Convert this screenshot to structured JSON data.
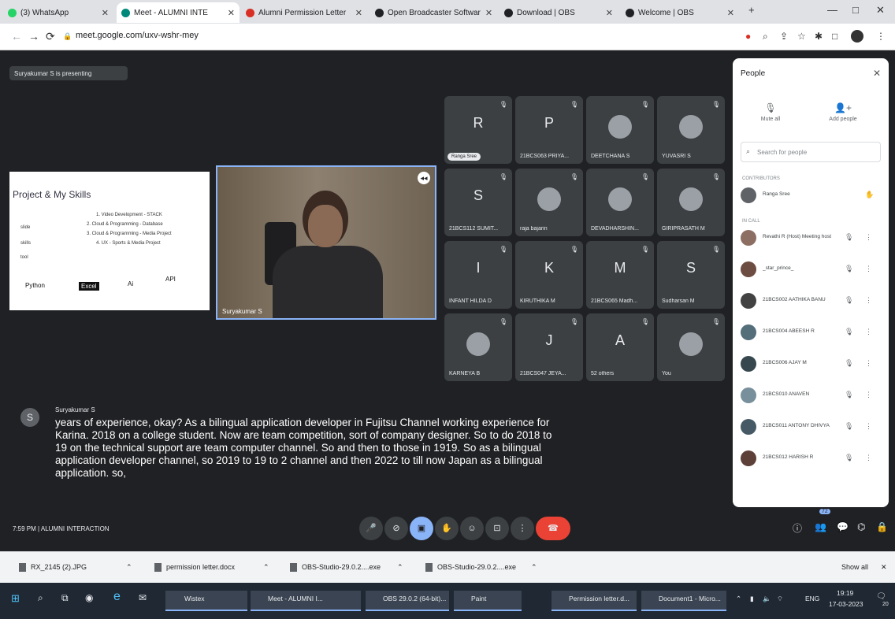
{
  "browser": {
    "tabs": [
      {
        "label": "(3) WhatsApp",
        "icon_color": "#25d366",
        "active": false
      },
      {
        "label": "Meet - ALUMNI INTE",
        "icon_color": "#00897b",
        "active": true
      },
      {
        "label": "Alumni Permission Letter",
        "icon_color": "#d93025",
        "active": false
      },
      {
        "label": "Open Broadcaster Softwar",
        "icon_color": "#202124",
        "active": false
      },
      {
        "label": "Download | OBS",
        "icon_color": "#202124",
        "active": false
      },
      {
        "label": "Welcome | OBS",
        "icon_color": "#202124",
        "active": false
      }
    ],
    "new_tab": "+",
    "window": {
      "minimize": "—",
      "maximize": "□",
      "close": "✕"
    },
    "url": "meet.google.com/uxv-wshr-mey"
  },
  "meet": {
    "presenting_banner": "Suryakumar S is presenting",
    "slide": {
      "title": "Project & My Skills",
      "lines": [
        "1. Video Development - STACK",
        "2. Cloud & Programming - Database",
        "3. Cloud & Programming - Media Project",
        "4. UX - Sports & Media Project"
      ],
      "side_labels": [
        "slide",
        "skills",
        "tool"
      ],
      "logos": [
        "Python",
        "Excel",
        "Ai",
        "API"
      ]
    },
    "camera": {
      "name": "Suryakumar S"
    },
    "participants": [
      {
        "initial": "R",
        "name": "Ranga Sree",
        "badge": true
      },
      {
        "initial": "P",
        "name": "21BCS063 PRIYA..."
      },
      {
        "initial": "",
        "name": "DEETCHANA S"
      },
      {
        "initial": "",
        "name": "YUVASRI S"
      },
      {
        "initial": "S",
        "name": "21BCS112 SUMIT..."
      },
      {
        "initial": "",
        "name": "raja bajarin"
      },
      {
        "initial": "",
        "name": "DEVADHARSHIN..."
      },
      {
        "initial": "",
        "name": "GIRIPRASATH M"
      },
      {
        "initial": "I",
        "name": "INFANT HILDA D"
      },
      {
        "initial": "K",
        "name": "KIRUTHIKA M"
      },
      {
        "initial": "M",
        "name": "21BCS065 Madh..."
      },
      {
        "initial": "S",
        "name": "Sudharsan M"
      },
      {
        "initial": "",
        "name": "KARNEYA B"
      },
      {
        "initial": "J",
        "name": "21BCS047 JEYA..."
      },
      {
        "initial": "A",
        "name": "52 others"
      },
      {
        "initial": "",
        "name": "You"
      }
    ],
    "caption": {
      "avatar": "S",
      "speaker": "Suryakumar S",
      "text": "years of experience, okay? As a bilingual application developer in Fujitsu Channel working experience for Karina. 2018 on a college student. Now are team competition, sort of company designer. So to do 2018 to 19 on the technical support are team computer channel. So and then to those in 1919. So as a bilingual application developer channel, so 2019 to 19 to 2 channel and then 2022 to till now Japan as a bilingual application. so,"
    },
    "footer": {
      "time": "7:59 PM",
      "separator": "|",
      "meeting_name": "ALUMNI INTERACTION",
      "people_count": "72"
    }
  },
  "people_panel": {
    "title": "People",
    "add_people": "Add people",
    "mute_all": "Mute all",
    "search_placeholder": "Search for people",
    "section_contributors": "CONTRIBUTORS",
    "contributor": {
      "name": "Ranga Sree",
      "color": "#5f6368"
    },
    "section_in_call": "IN CALL",
    "members": [
      {
        "name": "Revathi R (Host) Meeting host",
        "color": "#8d6e63"
      },
      {
        "name": "_star_prince_",
        "color": "#6d4c41"
      },
      {
        "name": "21BCS002 AATHIKA BANU",
        "color": "#424242"
      },
      {
        "name": "21BCS004 ABEESH R",
        "color": "#546e7a"
      },
      {
        "name": "21BCS006 AJAY M",
        "color": "#37474f"
      },
      {
        "name": "21BCS010 ANAVEN",
        "color": "#78909c"
      },
      {
        "name": "21BCS011 ANTONY DHIVYA",
        "color": "#455a64"
      },
      {
        "name": "21BCS012 HARISH R",
        "color": "#5d4037"
      }
    ]
  },
  "downloads": {
    "items": [
      "RX_2145 (2).JPG",
      "permission letter.docx",
      "OBS-Studio-29.0.2....exe",
      "OBS-Studio-29.0.2....exe"
    ],
    "show_all": "Show all"
  },
  "taskbar": {
    "items": [
      "Wistex",
      "Meet - ALUMNI I...",
      "OBS 29.0.2 (64-bit)...",
      "Paint",
      "Permission letter.d...",
      "Document1 - Micro..."
    ],
    "lang": "ENG",
    "time": "19:19",
    "date": "17-03-2023",
    "notif_count": "20"
  }
}
